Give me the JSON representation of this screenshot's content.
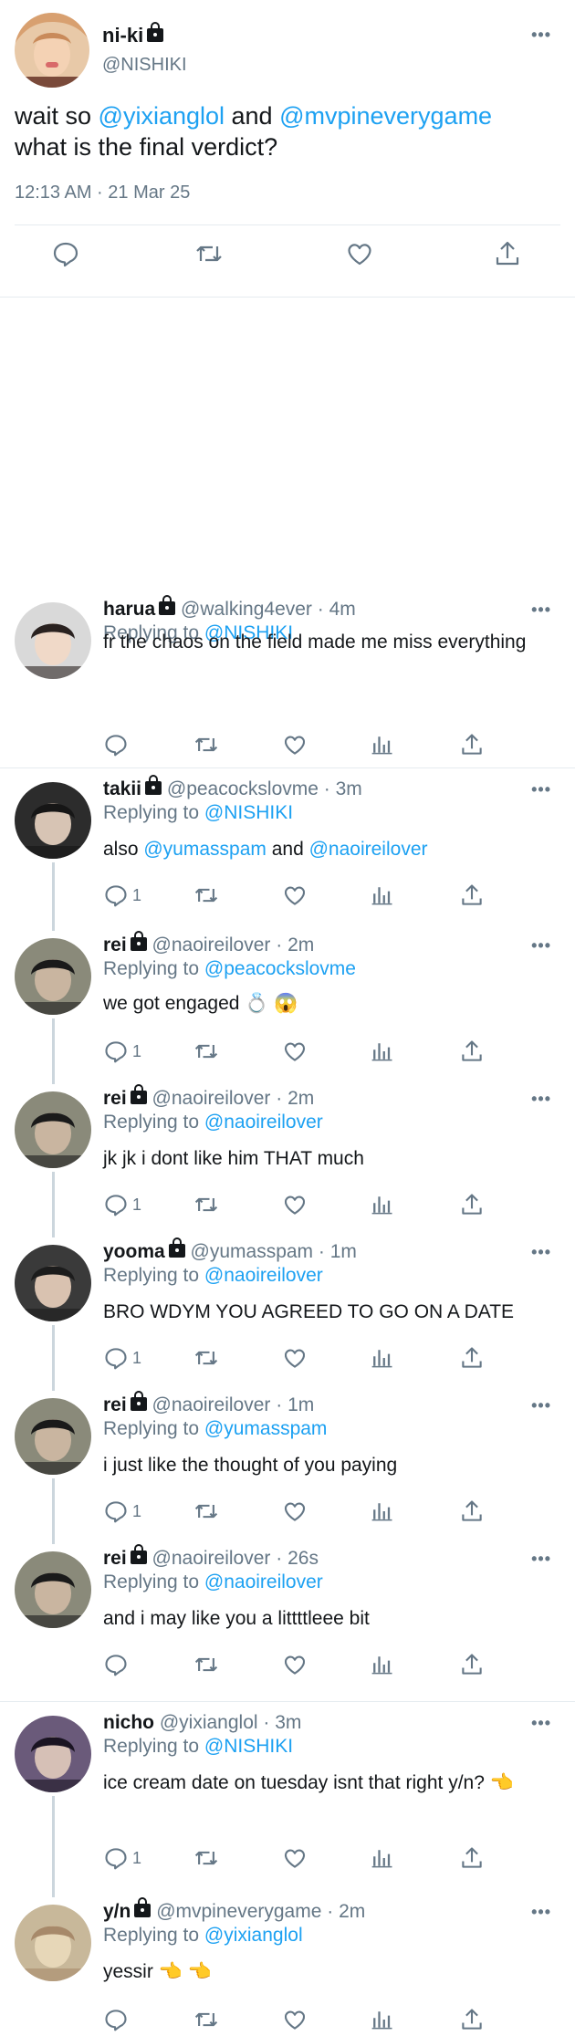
{
  "main_tweet": {
    "display_name": "ni-ki",
    "handle": "@NISHIKI",
    "text_parts": [
      "wait so ",
      "@yixianglol",
      " and ",
      "@mvpineverygame",
      " what is the final verdict?"
    ],
    "timestamp": "12:13 AM · 21 Mar 25"
  },
  "replies": [
    {
      "name": "harua",
      "handle": "@walking4ever",
      "time": "· 4m",
      "replying_label": "Replying to",
      "replying_to": "@NISHIKI",
      "text_parts": [
        "fr the chaos on the field made me miss everything"
      ],
      "reply_count": "",
      "locked": true
    },
    {
      "name": "takii",
      "handle": "@peacockslovme",
      "time": "· 3m",
      "replying_label": "Replying to",
      "replying_to": "@NISHIKI",
      "text_parts": [
        "also ",
        "@yumasspam",
        " and ",
        "@naoireilover"
      ],
      "reply_count": "1",
      "locked": true
    },
    {
      "name": "rei",
      "handle": "@naoireilover",
      "time": "· 2m",
      "replying_label": "Replying to",
      "replying_to": "@peacockslovme",
      "text_parts": [
        "we got engaged 💍 😱"
      ],
      "reply_count": "1",
      "locked": true
    },
    {
      "name": "rei",
      "handle": "@naoireilover",
      "time": "· 2m",
      "replying_label": "Replying to",
      "replying_to": "@naoireilover",
      "text_parts": [
        "jk jk i dont like him THAT much"
      ],
      "reply_count": "1",
      "locked": true
    },
    {
      "name": "yooma",
      "handle": "@yumasspam",
      "time": "· 1m",
      "replying_label": "Replying to",
      "replying_to": "@naoireilover",
      "text_parts": [
        "BRO WDYM YOU AGREED TO GO ON A DATE"
      ],
      "reply_count": "1",
      "locked": true
    },
    {
      "name": "rei",
      "handle": "@naoireilover",
      "time": "· 1m",
      "replying_label": "Replying to",
      "replying_to": "@yumasspam",
      "text_parts": [
        "i just like the thought of you paying"
      ],
      "reply_count": "1",
      "locked": true
    },
    {
      "name": "rei",
      "handle": "@naoireilover",
      "time": "· 26s",
      "replying_label": "Replying to",
      "replying_to": "@naoireilover",
      "text_parts": [
        "and i may like you a littttleee bit"
      ],
      "reply_count": "",
      "locked": true
    },
    {
      "name": "nicho",
      "handle": "@yixianglol",
      "time": "· 3m",
      "replying_label": "Replying to",
      "replying_to": "@NISHIKI",
      "text_parts": [
        "ice cream date on tuesday isnt that right y/n? 👈"
      ],
      "reply_count": "1",
      "locked": false
    },
    {
      "name": "y/n",
      "handle": "@mvpineverygame",
      "time": "· 2m",
      "replying_label": "Replying to",
      "replying_to": "@yixianglol",
      "text_parts": [
        "yessir 👈 👈"
      ],
      "reply_count": "",
      "locked": true
    }
  ],
  "colors": {
    "accent": "#1da1f2",
    "muted": "#657786",
    "divider": "#e6ecf0"
  }
}
